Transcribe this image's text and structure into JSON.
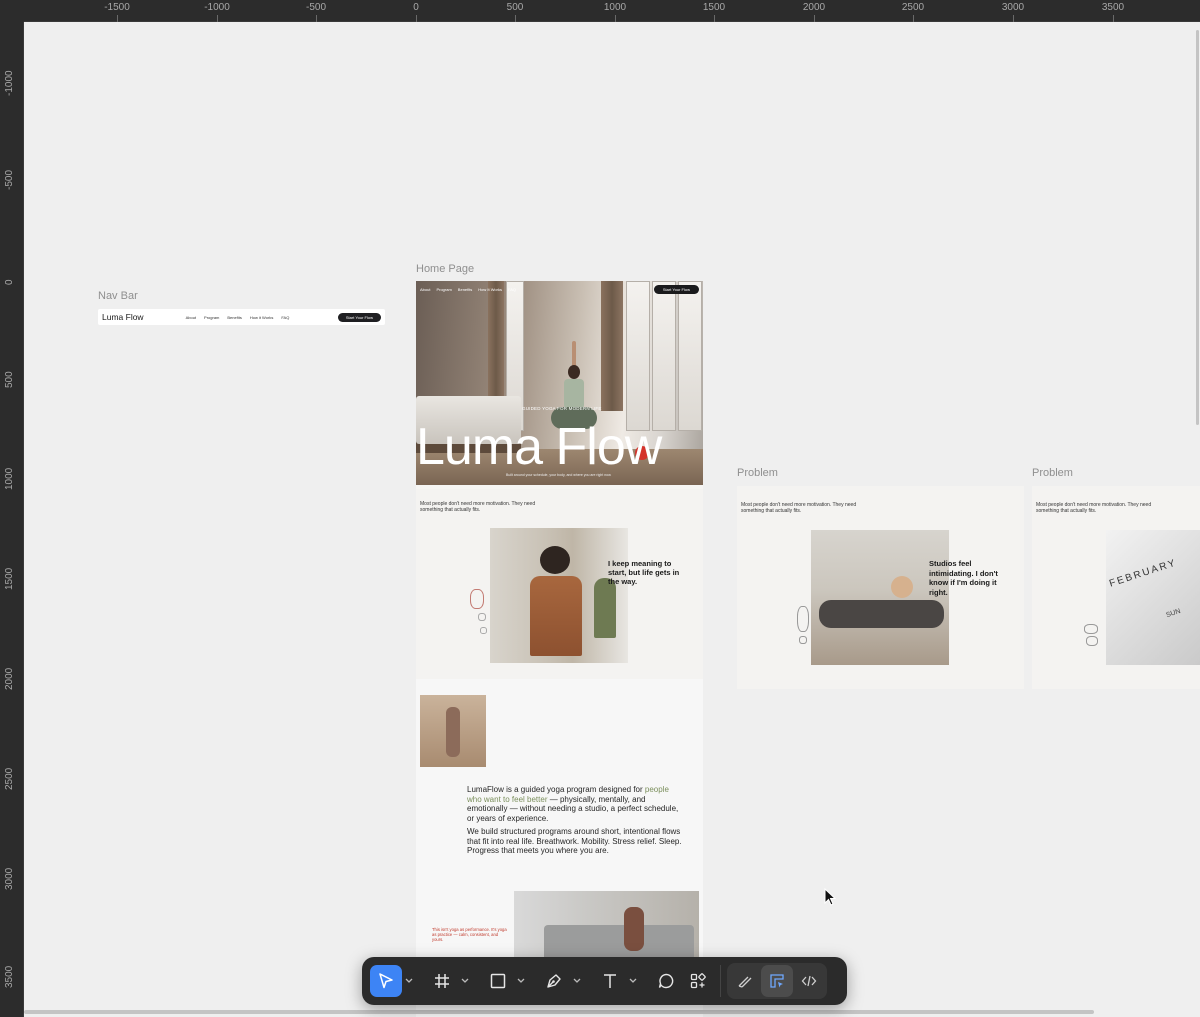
{
  "ruler": {
    "top_ticks": [
      "-1500",
      "-1000",
      "-500",
      "0",
      "500",
      "1000",
      "1500",
      "2000",
      "2500",
      "3000",
      "3500"
    ],
    "left_ticks": [
      "-1000",
      "-500",
      "0",
      "500",
      "1000",
      "1500",
      "2000",
      "2500",
      "3000",
      "3500"
    ]
  },
  "frames": {
    "navbar_label": "Nav Bar",
    "home_label": "Home Page",
    "problem_label_1": "Problem",
    "problem_label_2": "Problem"
  },
  "navbar": {
    "logo": "Luma Flow",
    "links": [
      "About",
      "Program",
      "Benefits",
      "How it Works",
      "FAQ"
    ],
    "cta": "Start Your Flow"
  },
  "home": {
    "hero": {
      "nav_links": [
        "About",
        "Program",
        "Benefits",
        "How It Works",
        "FAQ"
      ],
      "cta": "Start Your Flow",
      "kicker": "GUIDED YOGA FOR MODERN LIFE",
      "title": "Luma Flow",
      "subtitle": "Built around your schedule, your body, and where you are right now."
    },
    "problem": {
      "lead": "Most people don't need more motivation. They need something that actually fits.",
      "quote": "I keep meaning to start, but life gets in the way."
    },
    "about": {
      "p1_start": "LumaFlow is a guided yoga program designed for ",
      "p1_accent": "people who want to feel better",
      "p1_end": " — physically, mentally, and emotionally — without needing a studio, a perfect schedule, or years of experience.",
      "p2": "We build structured programs around short, intentional flows that fit into real life. Breathwork. Mobility. Stress relief. Sleep. Progress that meets you where you are.",
      "small": "This isn't yoga as performance. It's yoga as practice — calm, consistent, and yours."
    }
  },
  "problem_frame_1": {
    "lead": "Most people don't need more motivation. They need something that actually fits.",
    "quote": "Studios feel intimidating. I don't know if I'm doing it right."
  },
  "problem_frame_2": {
    "lead": "Most people don't need more motivation. They need something that actually fits.",
    "calendar_month": "FEBRUARY",
    "calendar_day": "SUN"
  },
  "toolbar": {
    "tools": [
      "move-tool",
      "frame-tool",
      "shape-tool",
      "pen-tool",
      "text-tool",
      "comment-tool",
      "actions-tool"
    ],
    "modes": [
      "draw-mode",
      "design-mode",
      "dev-mode"
    ],
    "active_tool": "move-tool",
    "active_mode": "design-mode",
    "accent_color": "#3d84f5"
  }
}
